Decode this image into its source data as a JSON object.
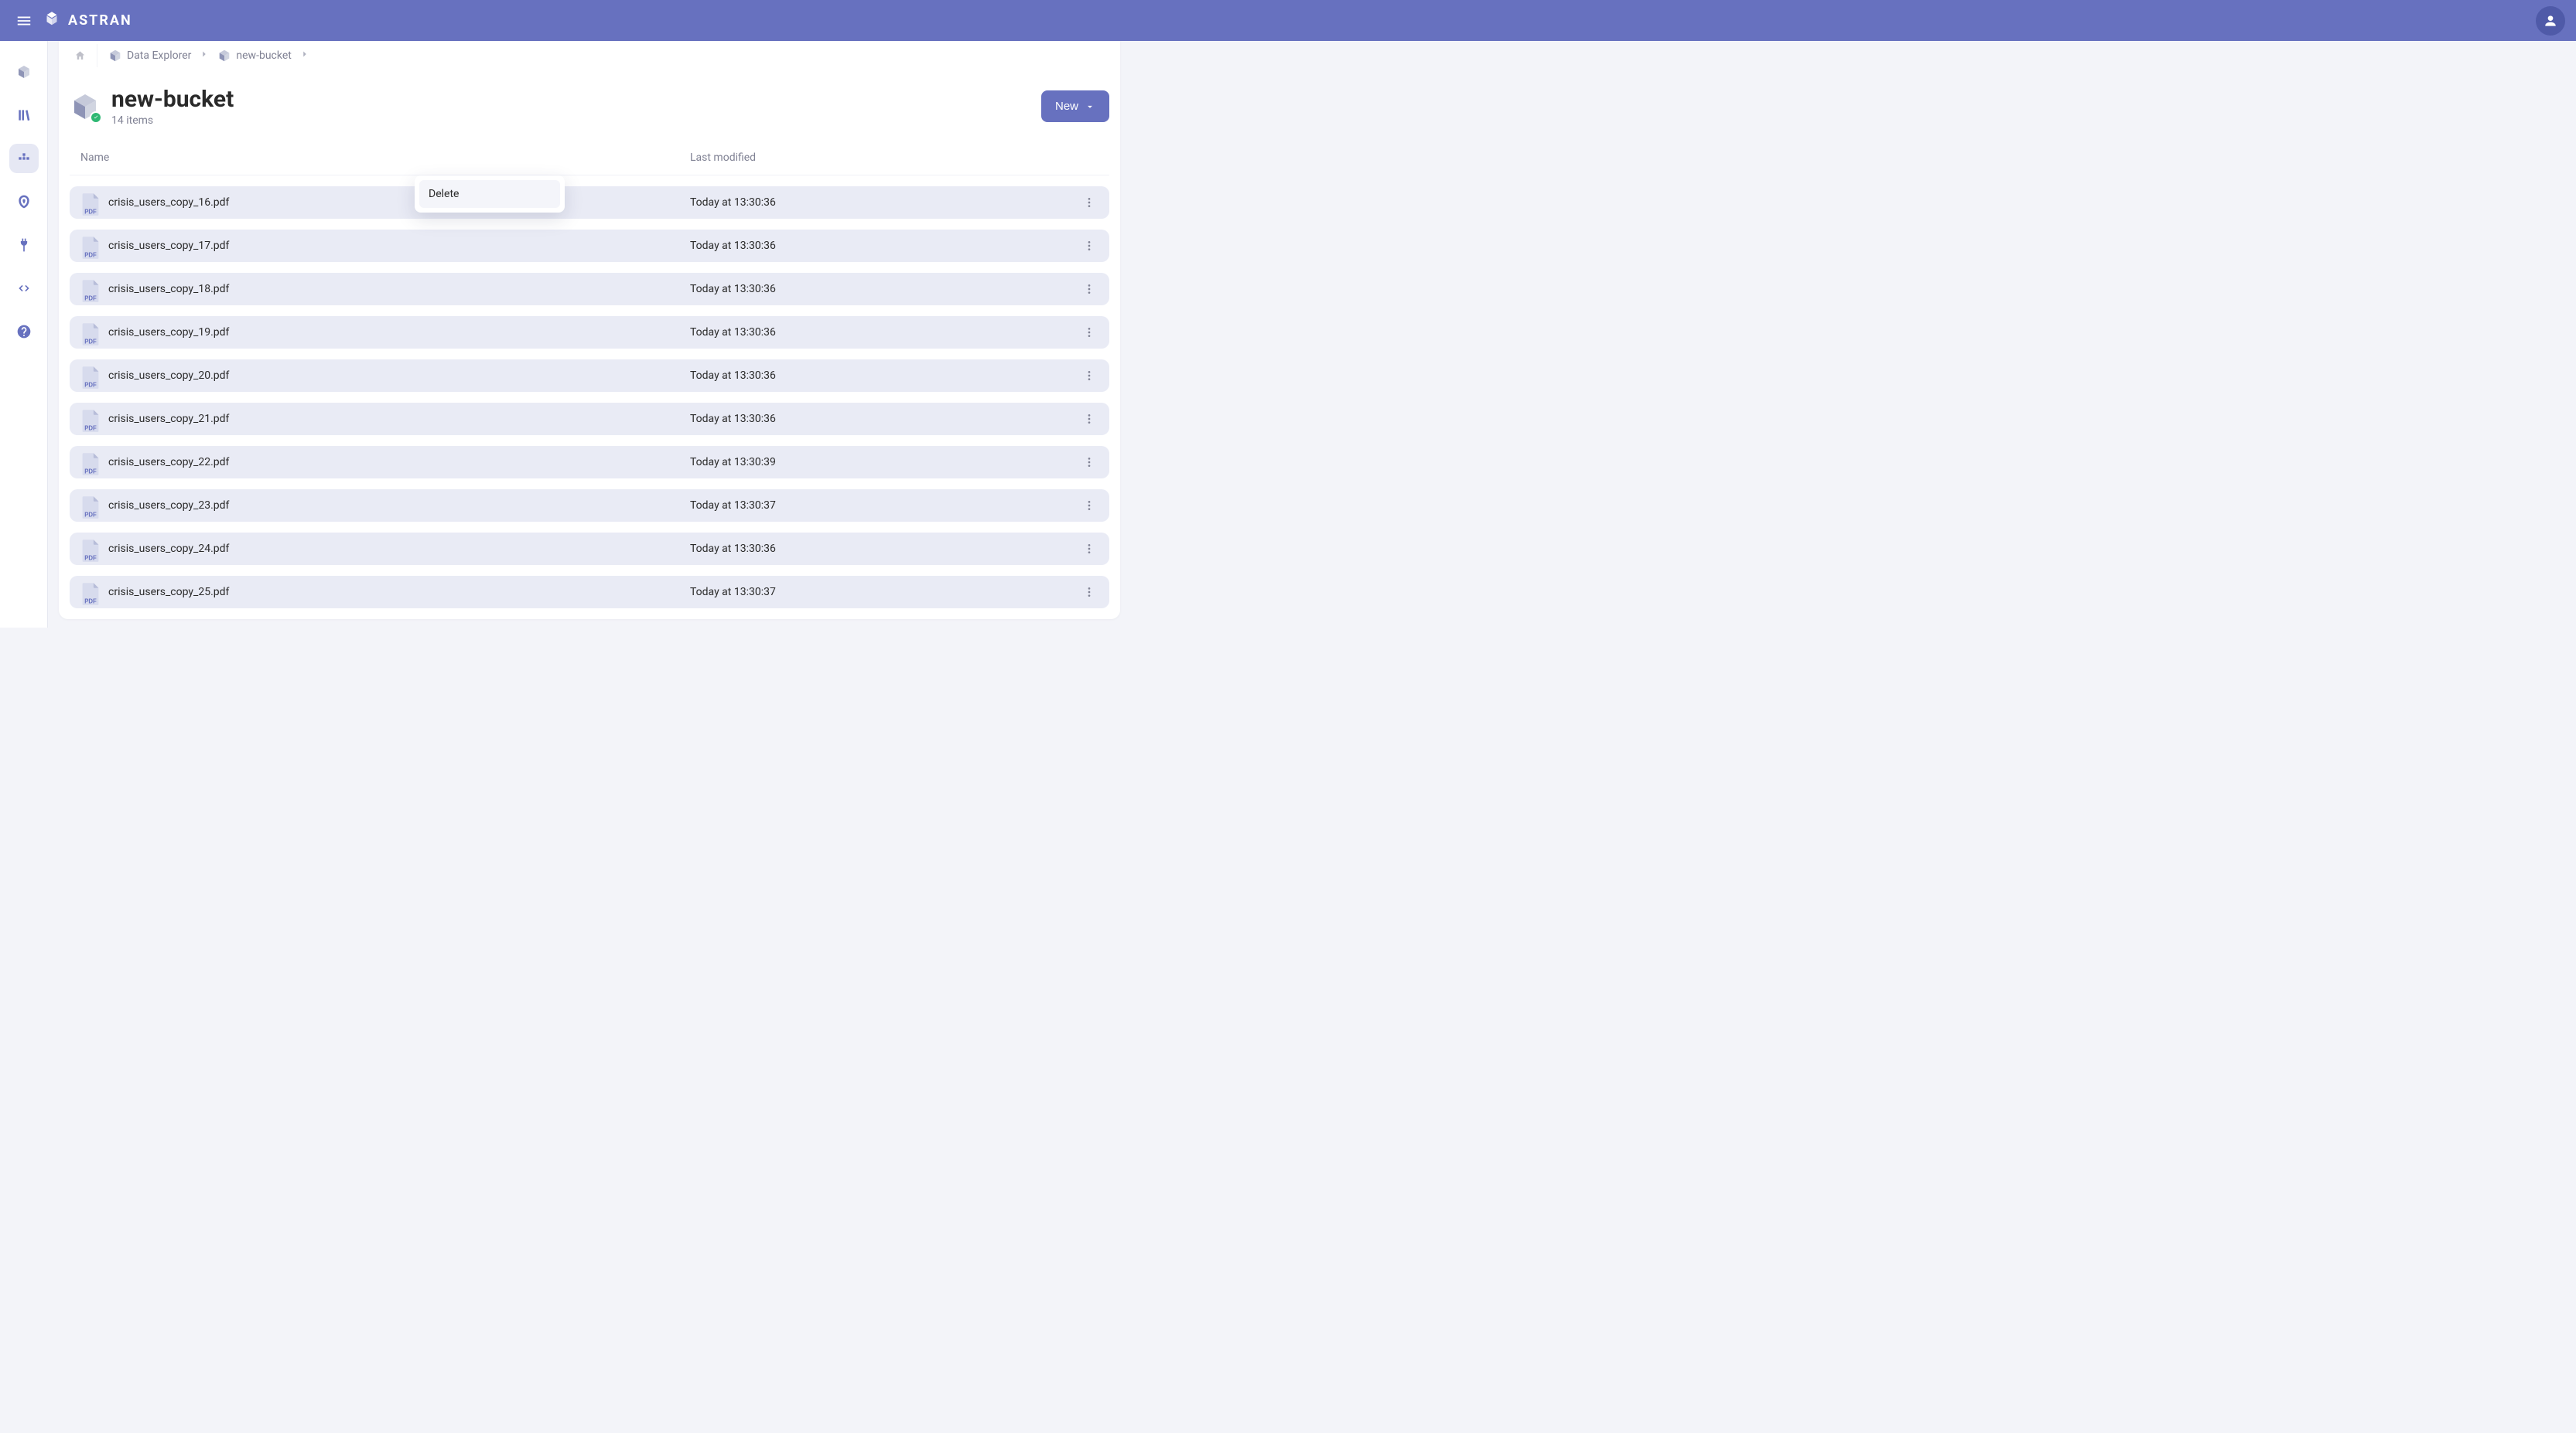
{
  "brand": {
    "name": "ASTRAN"
  },
  "breadcrumb": {
    "root": "Data Explorer",
    "current": "new-bucket"
  },
  "page": {
    "title": "new-bucket",
    "item_count_label": "14 items"
  },
  "buttons": {
    "new_label": "New"
  },
  "columns": {
    "name": "Name",
    "modified": "Last modified"
  },
  "context_menu": {
    "delete": "Delete"
  },
  "files": [
    {
      "name": "crisis_users_copy_16.pdf",
      "modified": "Today at 13:30:36"
    },
    {
      "name": "crisis_users_copy_17.pdf",
      "modified": "Today at 13:30:36"
    },
    {
      "name": "crisis_users_copy_18.pdf",
      "modified": "Today at 13:30:36"
    },
    {
      "name": "crisis_users_copy_19.pdf",
      "modified": "Today at 13:30:36"
    },
    {
      "name": "crisis_users_copy_20.pdf",
      "modified": "Today at 13:30:36"
    },
    {
      "name": "crisis_users_copy_21.pdf",
      "modified": "Today at 13:30:36"
    },
    {
      "name": "crisis_users_copy_22.pdf",
      "modified": "Today at 13:30:39"
    },
    {
      "name": "crisis_users_copy_23.pdf",
      "modified": "Today at 13:30:37"
    },
    {
      "name": "crisis_users_copy_24.pdf",
      "modified": "Today at 13:30:36"
    },
    {
      "name": "crisis_users_copy_25.pdf",
      "modified": "Today at 13:30:37"
    }
  ]
}
